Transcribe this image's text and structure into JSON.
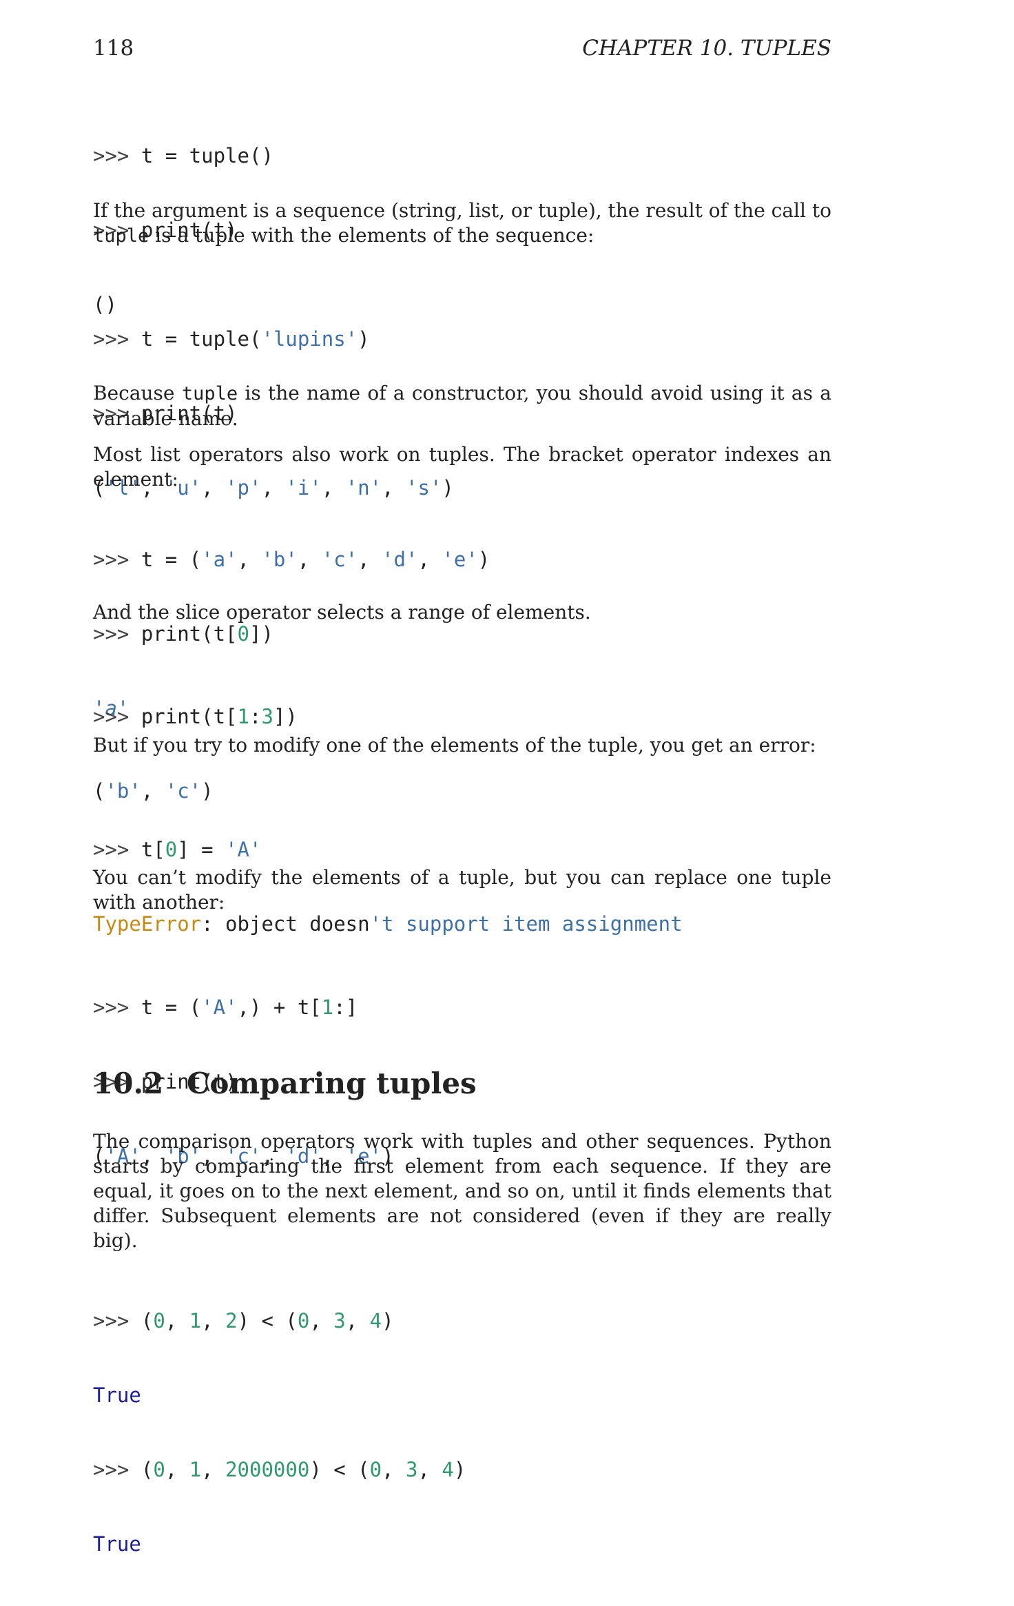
{
  "header": {
    "page_number": "118",
    "chapter_title": "CHAPTER 10.  TUPLES"
  },
  "code1": {
    "l1": [
      ">>> ",
      "t = tuple()"
    ],
    "l2": [
      ">>> ",
      "print(t)"
    ],
    "l3": [
      "()"
    ]
  },
  "para1": {
    "before": "If the argument is a sequence (string, list, or tuple), the result of the call to ",
    "code": "tuple",
    "after": " is a tuple with the elements of the sequence:"
  },
  "code2": {
    "l1": [
      ">>> ",
      "t = tuple(",
      "'lupins'",
      ")"
    ],
    "l2": [
      ">>> ",
      "print(t)"
    ],
    "l3": [
      "(",
      "'l'",
      ", ",
      "'u'",
      ", ",
      "'p'",
      ", ",
      "'i'",
      ", ",
      "'n'",
      ", ",
      "'s'",
      ")"
    ]
  },
  "para2": {
    "before": "Because ",
    "code": "tuple",
    "after": " is the name of a constructor, you should avoid using it as a variable name."
  },
  "para3": "Most list operators also work on tuples. The bracket operator indexes an element:",
  "code3": {
    "l1": [
      ">>> ",
      "t = (",
      "'a'",
      ", ",
      "'b'",
      ", ",
      "'c'",
      ", ",
      "'d'",
      ", ",
      "'e'",
      ")"
    ],
    "l2": [
      ">>> ",
      "print(t[",
      "0",
      "])"
    ],
    "l3": [
      "'a'"
    ]
  },
  "para4": "And the slice operator selects a range of elements.",
  "code4": {
    "l1": [
      ">>> ",
      "print(t[",
      "1",
      ":",
      "3",
      "])"
    ],
    "l2": [
      "(",
      "'b'",
      ", ",
      "'c'",
      ")"
    ]
  },
  "para5": "But if you try to modify one of the elements of the tuple, you get an error:",
  "code5": {
    "l1": [
      ">>> ",
      "t[",
      "0",
      "] = ",
      "'A'"
    ],
    "l2": [
      "TypeError",
      ": object doesn",
      "'t support item assignment"
    ]
  },
  "para6": "You can’t modify the elements of a tuple, but you can replace one tuple with another:",
  "code6": {
    "l1": [
      ">>> ",
      "t = (",
      "'A'",
      ",) + t[",
      "1",
      ":]"
    ],
    "l2": [
      ">>> ",
      "print(t)"
    ],
    "l3": [
      "(",
      "'A'",
      ", ",
      "'b'",
      ", ",
      "'c'",
      ", ",
      "'d'",
      ", ",
      "'e'",
      ")"
    ]
  },
  "section": {
    "number": "10.2",
    "title": "Comparing tuples"
  },
  "para7": "The comparison operators work with tuples and other sequences. Python starts by comparing the first element from each sequence. If they are equal, it goes on to the next element, and so on, until it finds elements that differ. Subsequent elements are not considered (even if they are really big).",
  "code7": {
    "l1": [
      ">>> ",
      "(",
      "0",
      ", ",
      "1",
      ", ",
      "2",
      ") < (",
      "0",
      ", ",
      "3",
      ", ",
      "4",
      ")"
    ],
    "l2": [
      "True"
    ],
    "l3": [
      ">>> ",
      "(",
      "0",
      ", ",
      "1",
      ", ",
      "2000000",
      ") < (",
      "0",
      ", ",
      "3",
      ", ",
      "4",
      ")"
    ],
    "l4": [
      "True"
    ]
  }
}
